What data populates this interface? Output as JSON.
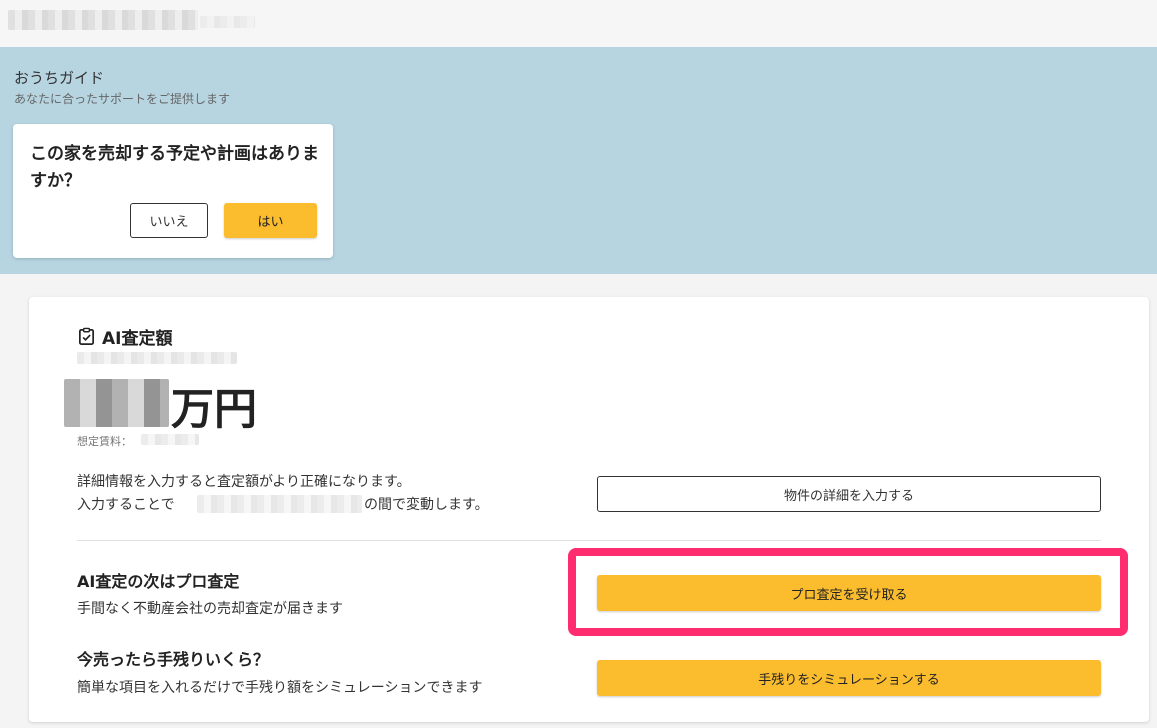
{
  "guide": {
    "title": "おうちガイド",
    "subtitle": "あなたに合ったサポートをご提供します",
    "question": "この家を売却する予定や計画はありますか？",
    "no_label": "いいえ",
    "yes_label": "はい"
  },
  "estimate": {
    "title": "AI査定額",
    "unit": "万円",
    "fee_label": "想定賃料：",
    "detail_line1": "詳細情報を入力すると査定額がより正確になります。",
    "detail_line2_prefix": "入力することで",
    "detail_line2_suffix": "の間で変動します。",
    "detail_button": "物件の詳細を入力する"
  },
  "pro": {
    "title": "AI査定の次はプロ査定",
    "subtitle": "手間なく不動産会社の売却査定が届きます",
    "button": "プロ査定を受け取る"
  },
  "simulation": {
    "title": "今売ったら手残りいくら？",
    "subtitle": "簡単な項目を入れるだけで手残り額をシミュレーションできます",
    "button": "手残りをシミュレーションする"
  },
  "colors": {
    "accent": "#fbbd2e",
    "band": "#b7d5e1",
    "highlight": "#ff2d6f"
  }
}
